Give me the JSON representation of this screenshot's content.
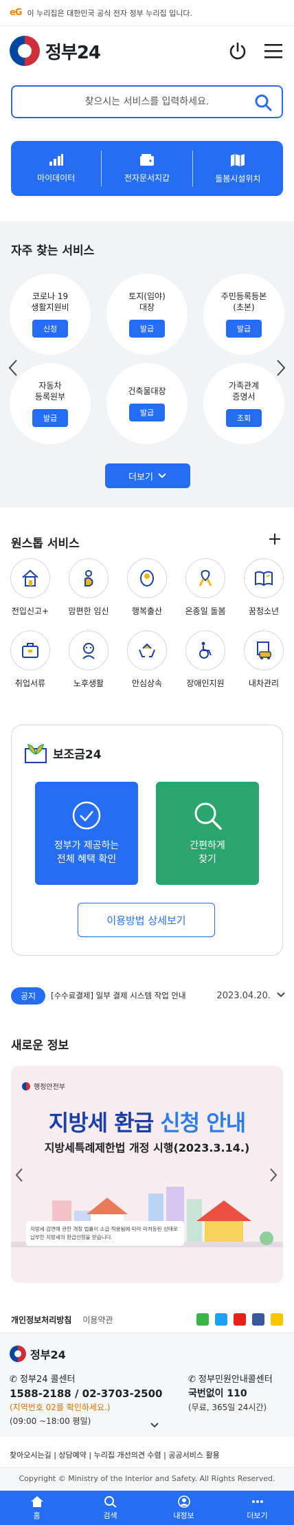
{
  "banner": {
    "mark": "eG",
    "text": "이 누리집은 대한민국 공식 전자 정부 누리집 입니다."
  },
  "header": {
    "logo": "정부24"
  },
  "search": {
    "placeholder": "찾으시는 서비스를 입력하세요."
  },
  "quick": [
    {
      "icon": "chart-bars-icon",
      "label": "마이데이터"
    },
    {
      "icon": "wallet-icon",
      "label": "전자문서지갑"
    },
    {
      "icon": "map-icon",
      "label": "돌봄시설위치"
    }
  ],
  "frequent": {
    "title": "자주 찾는 서비스",
    "items": [
      {
        "name": "코로나 19\n생활지원비",
        "action": "신청"
      },
      {
        "name": "토지(임야)\n대장",
        "action": "발급"
      },
      {
        "name": "주민등록등본\n(초본)",
        "action": "발급"
      },
      {
        "name": "자동차\n등록원부",
        "action": "발급"
      },
      {
        "name": "건축물대장",
        "action": "발급"
      },
      {
        "name": "가족관계\n증명서",
        "action": "조회"
      }
    ],
    "more": "더보기"
  },
  "onestop": {
    "title": "원스톱 서비스",
    "items": [
      {
        "label": "전입신고+"
      },
      {
        "label": "맘편한 임신"
      },
      {
        "label": "행복출산"
      },
      {
        "label": "온종일 돌봄"
      },
      {
        "label": "꿈청소년"
      },
      {
        "label": "취업서류"
      },
      {
        "label": "노후생활"
      },
      {
        "label": "안심상속"
      },
      {
        "label": "장애인지원"
      },
      {
        "label": "내차관리"
      }
    ]
  },
  "subsidy": {
    "title": "보조금24",
    "box1": "정부가 제공하는\n전체 혜택 확인",
    "box2": "간편하게\n찾기",
    "guide": "이용방법 상세보기",
    "colors": {
      "blue": "#256ef4",
      "green": "#2aa56d"
    }
  },
  "notice": {
    "badge": "공지",
    "text": "[수수료결제] 일부 결제 시스템 작업 안내",
    "date": "2023.04.20."
  },
  "news": {
    "title": "새로운 정보",
    "ministry": "행정안전부",
    "headline_a": "지방세 환급 ",
    "headline_b": "신청 안내",
    "subline": "지방세특례제한법 개정 시행(2023.3.14.)",
    "note": "지방세 감면에 관한 개정 법률이 소급 적용됨에 따라 미처등된 상태로 납부한 지방세의 환급신청을 받습니다."
  },
  "footer": {
    "privacy": "개인정보처리방침",
    "terms": "이용약관",
    "logo": "정부24",
    "center1": {
      "title": "정부24 콜센터",
      "phone": "1588-2188 / 02-3703-2500",
      "note": "(지역번호 02를 확인하세요.)",
      "hours": "(09:00 ~18:00 평일)"
    },
    "center2": {
      "title": "정부민원안내콜센터",
      "phone": "국번없이 110",
      "hours": "(무료, 365일 24시간)"
    },
    "links": "찾아오시는길 | 상담예약 | 누리집 개선의견 수렴 | 공공서비스 활용",
    "copyright": "Copyright © Ministry of the Interior and Safety. All Rights Reserved."
  },
  "nav": [
    {
      "icon": "home-icon",
      "label": "홈"
    },
    {
      "icon": "search-icon",
      "label": "검색"
    },
    {
      "icon": "user-icon",
      "label": "내정보"
    },
    {
      "icon": "more-icon",
      "label": "더보기"
    }
  ]
}
